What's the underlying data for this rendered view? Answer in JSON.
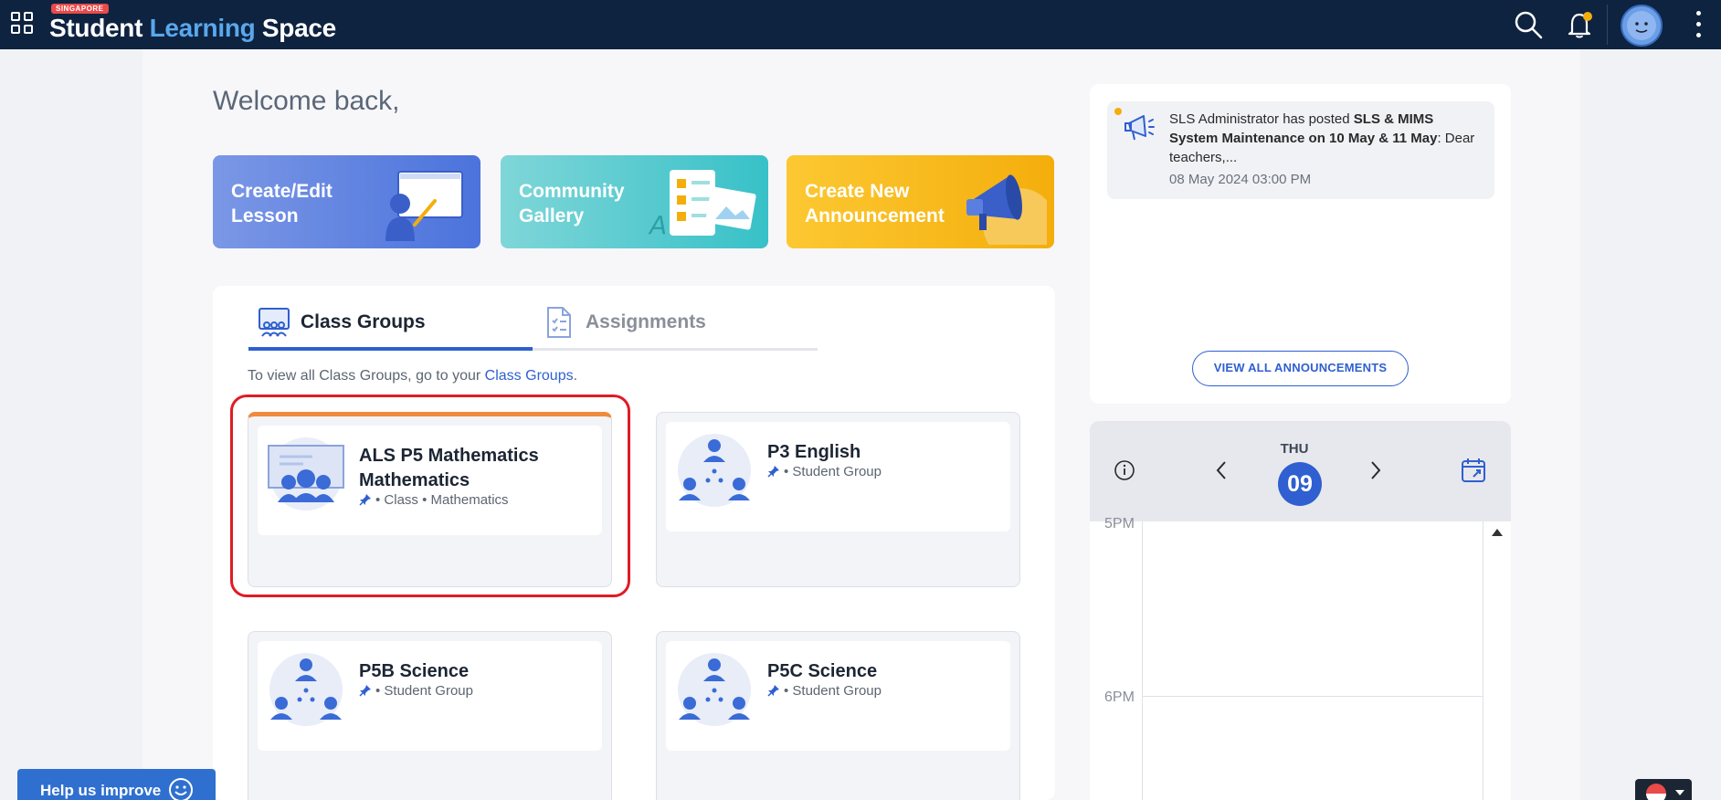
{
  "header": {
    "logo_badge": "SINGAPORE",
    "logo_word1": "Student",
    "logo_word2": "Learning",
    "logo_word3": "Space",
    "icons": [
      "apps-grid-icon",
      "search-icon",
      "bell-icon",
      "avatar",
      "more-vertical-icon"
    ],
    "notification_dot_color": "#f4ae0c"
  },
  "welcome": "Welcome back,",
  "quick_actions": [
    {
      "label": "Create/Edit Lesson",
      "color": "#5a7fe0"
    },
    {
      "label": "Community Gallery",
      "color": "#4dc7cc"
    },
    {
      "label": "Create New Announcement",
      "color": "#f7b81a"
    }
  ],
  "tabs": [
    {
      "label": "Class Groups",
      "active": true
    },
    {
      "label": "Assignments",
      "active": false
    }
  ],
  "hint": {
    "prefix": "To view all Class Groups, go to your",
    "link": "Class Groups",
    "suffix": "."
  },
  "class_groups": [
    {
      "title": "ALS P5 Mathematics Mathematics",
      "meta": "• Class • Mathematics"
    },
    {
      "title": "P3 English",
      "meta": "• Student Group"
    },
    {
      "title": "P5B Science",
      "meta": "• Student Group"
    },
    {
      "title": "P5C Science",
      "meta": "• Student Group"
    }
  ],
  "announcement": {
    "prefix": "SLS Administrator has posted",
    "title": "SLS & MIMS System Maintenance on 10 May & 11 May",
    "body": ": Dear teachers,...",
    "date": "08 May 2024 03:00 PM"
  },
  "view_all": "VIEW ALL ANNOUNCEMENTS",
  "calendar": {
    "day": "THU",
    "date": "09",
    "times": [
      "5PM",
      "6PM"
    ]
  },
  "feedback": "Help us improve",
  "accent": "#2f5fd0"
}
